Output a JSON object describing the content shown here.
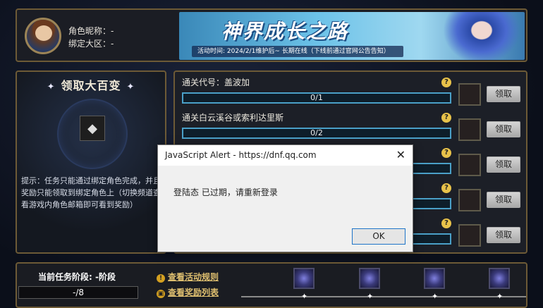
{
  "top": {
    "nickname_label": "角色昵称：-",
    "server_label": "绑定大区：-",
    "banner_title": "神界成长之路",
    "banner_time": "活动时间: 2024/2/1维护后~ 长期在线（下线前通过官网公告告知）"
  },
  "left": {
    "title": "领取大百变",
    "star": "✦",
    "tip": "提示：任务只能通过绑定角色完成，并且奖励只能领取到绑定角色上（切换频道查看游戏内角色邮箱即可看到奖励）"
  },
  "tasks": [
    {
      "name": "通关代号：盖波加",
      "progress": "0/1",
      "button": "领取"
    },
    {
      "name": "通关白云溪谷或索利达里斯",
      "progress": "0/2",
      "button": "领取"
    },
    {
      "name": "",
      "progress": "",
      "button": "领取"
    },
    {
      "name": "",
      "progress": "",
      "button": "领取"
    },
    {
      "name": "",
      "progress": "",
      "button": "领取"
    }
  ],
  "help_glyph": "?",
  "bottom": {
    "stage_label": "当前任务阶段: -阶段",
    "stage_value": "-/8",
    "rules_link": "查看活动规则",
    "rewards_link": "查看奖励列表"
  },
  "dialog": {
    "title": "JavaScript Alert - https://dnf.qq.com",
    "close": "✕",
    "message": "登陆态 已过期，请重新登录",
    "ok": "OK"
  }
}
